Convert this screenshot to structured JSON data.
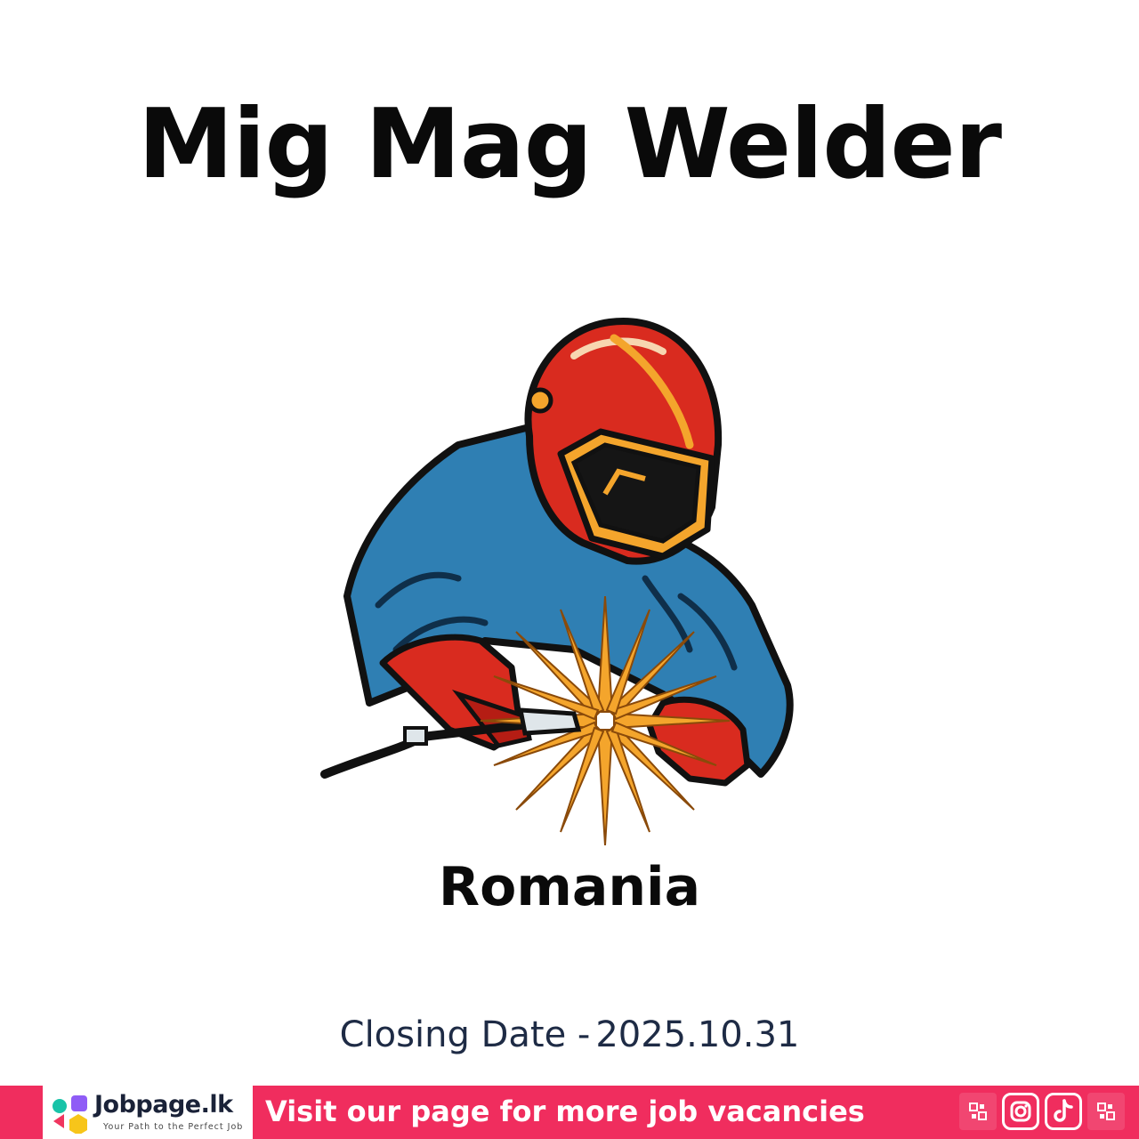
{
  "job": {
    "title": "Mig Mag Welder",
    "country": "Romania",
    "closing_label": "Closing Date -",
    "closing_date": "2025.10.31"
  },
  "banner": {
    "brand_name": "Jobpage.lk",
    "brand_tagline": "Your Path to the Perfect Job",
    "cta": "Visit our page for more job vacancies",
    "social_icons": [
      "qr-icon",
      "instagram-icon",
      "tiktok-icon",
      "qr-icon"
    ]
  },
  "colors": {
    "banner": "#f02d5e",
    "helmet": "#d92b1f",
    "jacket": "#2f7fb3",
    "spark": "#f4a52c",
    "closing_text": "#1e2b45"
  }
}
